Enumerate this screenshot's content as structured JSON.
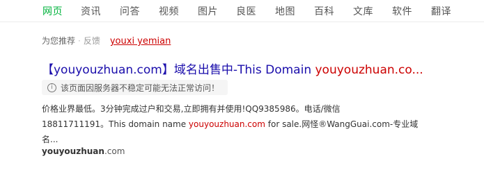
{
  "tabs": [
    "网页",
    "资讯",
    "问答",
    "视频",
    "图片",
    "良医",
    "地图",
    "百科",
    "文库",
    "软件",
    "翻译"
  ],
  "recommend": {
    "label": "为您推荐",
    "separator": "·",
    "feedback": "反馈",
    "keyword": "youxi yemian"
  },
  "result": {
    "title_prefix": "【youyouzhuan.com】域名出售中-This Domain ",
    "title_highlight": "youyouzhuan.co...",
    "warning": "该页面因服务器不稳定可能无法正常访问！",
    "warning_icon": "info-icon",
    "snippet_line1": "价格业界最低。3分钟完成过户和交易,立即拥有并使用!QQ9385986。电话/微信",
    "snippet_line2_pre": "18811711191。This domain name ",
    "snippet_highlight": "youyouzhuan.com",
    "snippet_line2_post": " for sale.网怪®WangGuai.com-专业域",
    "snippet_line3": "名...",
    "site_bold": "youyouzhuan",
    "site_rest": ".com"
  },
  "colors": {
    "active_tab": "#00b33c",
    "link": "#1a0dab",
    "highlight": "#cc0000"
  }
}
